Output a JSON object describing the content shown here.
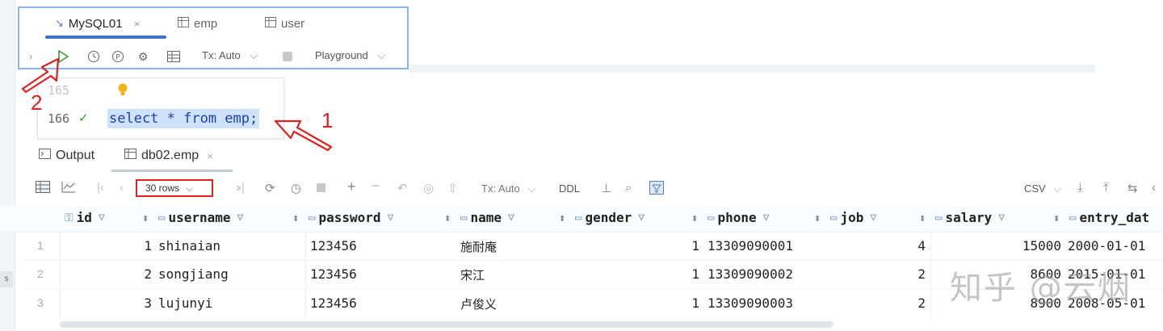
{
  "tabs": [
    {
      "label": "MySQL01",
      "icon": "console-icon"
    },
    {
      "label": "emp",
      "icon": "table-icon"
    },
    {
      "label": "user",
      "icon": "table-icon"
    }
  ],
  "toolbar": {
    "tx_label": "Tx: Auto",
    "playground_label": "Playground"
  },
  "editor": {
    "lines": [
      {
        "number": "165"
      },
      {
        "number": "166",
        "code": "select * from emp;"
      }
    ]
  },
  "results": {
    "tabs": [
      {
        "label": "Output"
      },
      {
        "label": "db02.emp"
      }
    ],
    "rows_selector": "30 rows",
    "tx_label": "Tx: Auto",
    "ddl_label": "DDL",
    "export_label": "CSV",
    "columns": [
      {
        "name": "id",
        "icon": "key-column-icon"
      },
      {
        "name": "username",
        "icon": "column-icon"
      },
      {
        "name": "password",
        "icon": "column-icon"
      },
      {
        "name": "name",
        "icon": "column-icon"
      },
      {
        "name": "gender",
        "icon": "column-icon"
      },
      {
        "name": "phone",
        "icon": "column-icon"
      },
      {
        "name": "job",
        "icon": "column-icon"
      },
      {
        "name": "salary",
        "icon": "column-icon"
      },
      {
        "name": "entry_dat",
        "icon": "column-icon"
      }
    ],
    "rows": [
      {
        "rownum": "1",
        "id": "1",
        "username": "shinaian",
        "password": "123456",
        "name": "施耐庵",
        "gender": "1",
        "phone": "13309090001",
        "job": "4",
        "salary": "15000",
        "entry_date": "2000-01-01"
      },
      {
        "rownum": "2",
        "id": "2",
        "username": "songjiang",
        "password": "123456",
        "name": "宋江",
        "gender": "1",
        "phone": "13309090002",
        "job": "2",
        "salary": "8600",
        "entry_date": "2015-01-01"
      },
      {
        "rownum": "3",
        "id": "3",
        "username": "lujunyi",
        "password": "123456",
        "name": "卢俊义",
        "gender": "1",
        "phone": "13309090003",
        "job": "2",
        "salary": "8900",
        "entry_date": "2008-05-01"
      }
    ]
  },
  "annotations": {
    "note1": "1",
    "note2": "2"
  },
  "watermark": "知乎 @云烟",
  "colors": {
    "accent": "#3e73c8",
    "annotation": "#dd2222",
    "selection": "#cfe2fb"
  }
}
